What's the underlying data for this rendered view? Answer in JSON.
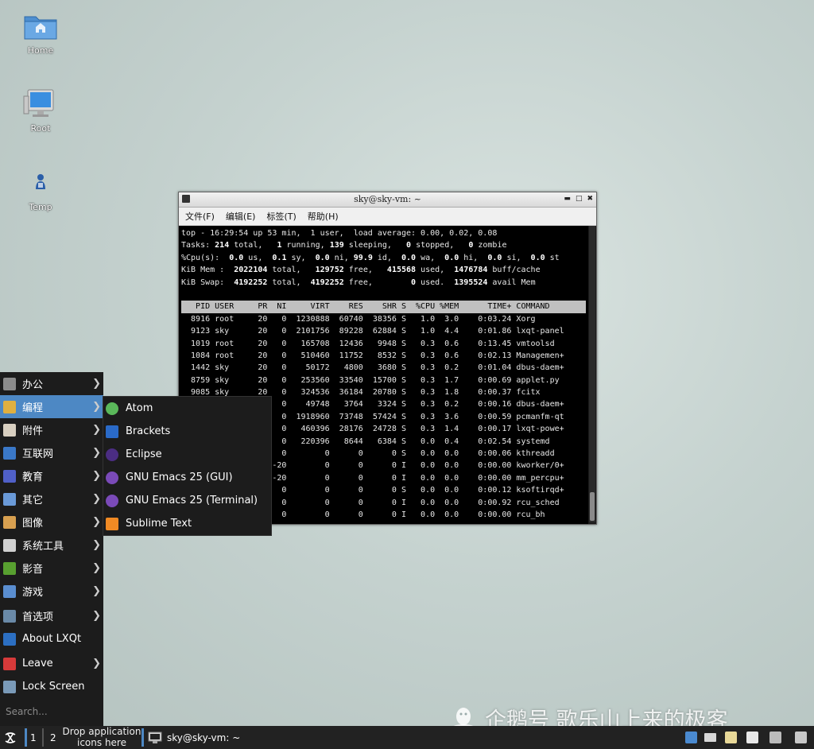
{
  "desktop": {
    "icons": [
      {
        "label": "Home",
        "icon": "folder-home-icon"
      },
      {
        "label": "Root",
        "icon": "computer-icon"
      },
      {
        "label": "Temp",
        "icon": "user-icon"
      }
    ]
  },
  "terminal": {
    "title": "sky@sky-vm: ~",
    "menu": [
      "文件(F)",
      "编辑(E)",
      "标签(T)",
      "帮助(H)"
    ],
    "summary": {
      "line1": "top - 16:29:54 up 53 min,  1 user,  load average: 0.00, 0.02, 0.08",
      "tasks": {
        "total": "214",
        "running": "1",
        "sleeping": "139",
        "stopped": "0",
        "zombie": "0"
      },
      "cpu": {
        "us": "0.0",
        "sy": "0.1",
        "ni": "0.0",
        "id": "99.9",
        "wa": "0.0",
        "hi": "0.0",
        "si": "0.0",
        "st": "0.0"
      },
      "mem": {
        "total": "2022104",
        "free": "129752",
        "used": "415568",
        "buff": "1476784"
      },
      "swap": {
        "total": "4192252",
        "free": "4192252",
        "used": "0",
        "avail": "1395524"
      }
    },
    "columns": [
      "PID",
      "USER",
      "PR",
      "NI",
      "VIRT",
      "RES",
      "SHR",
      "S",
      "%CPU",
      "%MEM",
      "TIME+",
      "COMMAND"
    ],
    "processes": [
      {
        "pid": "8916",
        "user": "root",
        "pr": "20",
        "ni": "0",
        "virt": "1230888",
        "res": "60740",
        "shr": "38356",
        "s": "S",
        "cpu": "1.0",
        "mem": "3.0",
        "time": "0:03.24",
        "cmd": "Xorg"
      },
      {
        "pid": "9123",
        "user": "sky",
        "pr": "20",
        "ni": "0",
        "virt": "2101756",
        "res": "89228",
        "shr": "62884",
        "s": "S",
        "cpu": "1.0",
        "mem": "4.4",
        "time": "0:01.86",
        "cmd": "lxqt-panel"
      },
      {
        "pid": "1019",
        "user": "root",
        "pr": "20",
        "ni": "0",
        "virt": "165708",
        "res": "12436",
        "shr": "9948",
        "s": "S",
        "cpu": "0.3",
        "mem": "0.6",
        "time": "0:13.45",
        "cmd": "vmtoolsd"
      },
      {
        "pid": "1084",
        "user": "root",
        "pr": "20",
        "ni": "0",
        "virt": "510460",
        "res": "11752",
        "shr": "8532",
        "s": "S",
        "cpu": "0.3",
        "mem": "0.6",
        "time": "0:02.13",
        "cmd": "Managemen+"
      },
      {
        "pid": "1442",
        "user": "sky",
        "pr": "20",
        "ni": "0",
        "virt": "50172",
        "res": "4800",
        "shr": "3680",
        "s": "S",
        "cpu": "0.3",
        "mem": "0.2",
        "time": "0:01.04",
        "cmd": "dbus-daem+"
      },
      {
        "pid": "8759",
        "user": "sky",
        "pr": "20",
        "ni": "0",
        "virt": "253560",
        "res": "33540",
        "shr": "15700",
        "s": "S",
        "cpu": "0.3",
        "mem": "1.7",
        "time": "0:00.69",
        "cmd": "applet.py"
      },
      {
        "pid": "9085",
        "user": "sky",
        "pr": "20",
        "ni": "0",
        "virt": "324536",
        "res": "36184",
        "shr": "20780",
        "s": "S",
        "cpu": "0.3",
        "mem": "1.8",
        "time": "0:00.37",
        "cmd": "fcitx"
      },
      {
        "pid": "",
        "user": "",
        "pr": "",
        "ni": "0",
        "virt": "49748",
        "res": "3764",
        "shr": "3324",
        "s": "S",
        "cpu": "0.3",
        "mem": "0.2",
        "time": "0:00.16",
        "cmd": "dbus-daem+"
      },
      {
        "pid": "",
        "user": "",
        "pr": "",
        "ni": "0",
        "virt": "1918960",
        "res": "73748",
        "shr": "57424",
        "s": "S",
        "cpu": "0.3",
        "mem": "3.6",
        "time": "0:00.59",
        "cmd": "pcmanfm-qt"
      },
      {
        "pid": "",
        "user": "",
        "pr": "",
        "ni": "0",
        "virt": "460396",
        "res": "28176",
        "shr": "24728",
        "s": "S",
        "cpu": "0.3",
        "mem": "1.4",
        "time": "0:00.17",
        "cmd": "lxqt-powe+"
      },
      {
        "pid": "",
        "user": "",
        "pr": "",
        "ni": "0",
        "virt": "220396",
        "res": "8644",
        "shr": "6384",
        "s": "S",
        "cpu": "0.0",
        "mem": "0.4",
        "time": "0:02.54",
        "cmd": "systemd"
      },
      {
        "pid": "",
        "user": "",
        "pr": "",
        "ni": "0",
        "virt": "0",
        "res": "0",
        "shr": "0",
        "s": "S",
        "cpu": "0.0",
        "mem": "0.0",
        "time": "0:00.06",
        "cmd": "kthreadd"
      },
      {
        "pid": "",
        "user": "",
        "pr": "",
        "ni": "-20",
        "virt": "0",
        "res": "0",
        "shr": "0",
        "s": "I",
        "cpu": "0.0",
        "mem": "0.0",
        "time": "0:00.00",
        "cmd": "kworker/0+"
      },
      {
        "pid": "",
        "user": "",
        "pr": "",
        "ni": "-20",
        "virt": "0",
        "res": "0",
        "shr": "0",
        "s": "I",
        "cpu": "0.0",
        "mem": "0.0",
        "time": "0:00.00",
        "cmd": "mm_percpu+"
      },
      {
        "pid": "",
        "user": "",
        "pr": "",
        "ni": "0",
        "virt": "0",
        "res": "0",
        "shr": "0",
        "s": "S",
        "cpu": "0.0",
        "mem": "0.0",
        "time": "0:00.12",
        "cmd": "ksoftirqd+"
      },
      {
        "pid": "",
        "user": "",
        "pr": "",
        "ni": "0",
        "virt": "0",
        "res": "0",
        "shr": "0",
        "s": "I",
        "cpu": "0.0",
        "mem": "0.0",
        "time": "0:00.92",
        "cmd": "rcu_sched"
      },
      {
        "pid": "",
        "user": "",
        "pr": "",
        "ni": "0",
        "virt": "0",
        "res": "0",
        "shr": "0",
        "s": "I",
        "cpu": "0.0",
        "mem": "0.0",
        "time": "0:00.00",
        "cmd": "rcu_bh"
      }
    ]
  },
  "start_menu": {
    "items": [
      {
        "label": "办公",
        "icon": "office-icon",
        "color": "#8c8c8c",
        "has_submenu": true
      },
      {
        "label": "编程",
        "icon": "programming-icon",
        "color": "#e0b040",
        "has_submenu": true,
        "active": true
      },
      {
        "label": "附件",
        "icon": "accessories-icon",
        "color": "#d8cfc0",
        "has_submenu": true
      },
      {
        "label": "互联网",
        "icon": "internet-icon",
        "color": "#3a78c8",
        "has_submenu": true
      },
      {
        "label": "教育",
        "icon": "education-icon",
        "color": "#5060c8",
        "has_submenu": true
      },
      {
        "label": "其它",
        "icon": "other-icon",
        "color": "#6a9ad8",
        "has_submenu": true
      },
      {
        "label": "图像",
        "icon": "graphics-icon",
        "color": "#d8a050",
        "has_submenu": true
      },
      {
        "label": "系统工具",
        "icon": "system-tools-icon",
        "color": "#d0d0d0",
        "has_submenu": true
      },
      {
        "label": "影音",
        "icon": "multimedia-icon",
        "color": "#58a030",
        "has_submenu": true
      },
      {
        "label": "游戏",
        "icon": "games-icon",
        "color": "#5a8ed0",
        "has_submenu": true
      },
      {
        "label": "首选项",
        "icon": "preferences-icon",
        "color": "#6a8aa8",
        "has_submenu": true
      },
      {
        "label": "About LXQt",
        "icon": "info-icon",
        "color": "#2c6fc2",
        "has_submenu": false
      },
      {
        "label": "Leave",
        "icon": "power-icon",
        "color": "#d63a3a",
        "has_submenu": true
      },
      {
        "label": "Lock Screen",
        "icon": "lock-screen-icon",
        "color": "#7a9ab8",
        "has_submenu": false
      }
    ],
    "search_placeholder": "Search..."
  },
  "programming_submenu": [
    {
      "label": "Atom",
      "icon": "atom-icon",
      "color": "#5ab85a"
    },
    {
      "label": "Brackets",
      "icon": "brackets-icon",
      "color": "#2a6ac8"
    },
    {
      "label": "Eclipse",
      "icon": "eclipse-icon",
      "color": "#4b2d82"
    },
    {
      "label": "GNU Emacs 25 (GUI)",
      "icon": "emacs-icon",
      "color": "#7a4ab8"
    },
    {
      "label": "GNU Emacs 25 (Terminal)",
      "icon": "emacs-icon",
      "color": "#7a4ab8"
    },
    {
      "label": "Sublime Text",
      "icon": "sublime-text-icon",
      "color": "#f08a24"
    }
  ],
  "taskbar": {
    "desktops": [
      "1",
      "2"
    ],
    "drop_area": "Drop application icons here",
    "task_label": "sky@sky-vm: ~",
    "accent": "#4d88c4",
    "tray_icons": [
      "search-icon",
      "keyboard-icon",
      "clipboard-icon",
      "removable-drive-icon",
      "volume-icon",
      "network-icon"
    ]
  },
  "watermark": "企鹅号 歌乐山上来的极客"
}
